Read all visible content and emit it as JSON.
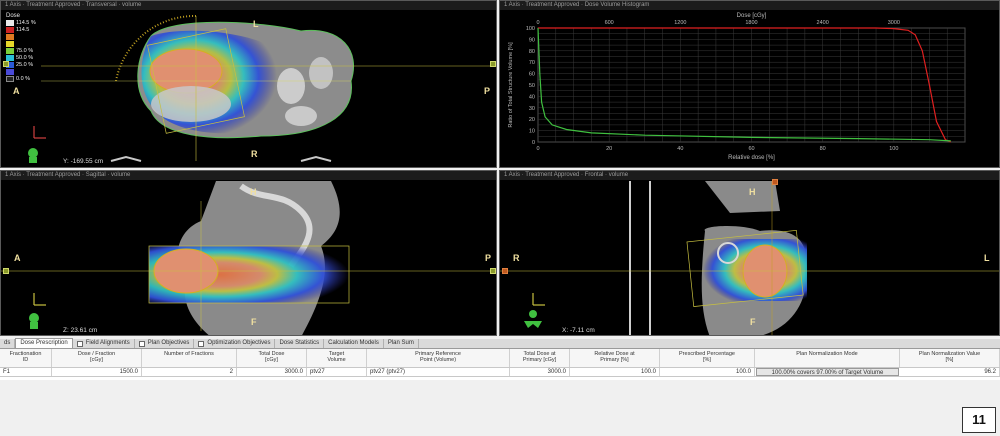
{
  "transverse": {
    "title": "1 Axis · Treatment Approved · Transversal · volume",
    "orient": {
      "top": "L",
      "left": "A",
      "right": "P",
      "bottom": "R"
    },
    "coord": "Y: -169.55 cm"
  },
  "dvh": {
    "title": "1 Axis · Treatment Approved · Dose Volume Histogram",
    "x_title_top": "Dose [cGy]",
    "x_title_bottom": "Relative dose [%]",
    "y_title": "Ratio of Total Structure Volume [%]"
  },
  "sagittal": {
    "title": "1 Axis · Treatment Approved · Sagittal · volume",
    "orient": {
      "top": "H",
      "left": "A",
      "right": "P",
      "bottom": "F"
    },
    "coord": "Z: 23.61 cm"
  },
  "frontal": {
    "title": "1 Axis · Treatment Approved · Frontal · volume",
    "orient": {
      "top": "H",
      "left": "R",
      "right": "L",
      "bottom": "F"
    },
    "coord": "X: -7.11 cm"
  },
  "legend": {
    "header": "Dose",
    "items": [
      {
        "label": "114.5 %",
        "color": "#e8e8e8"
      },
      {
        "label": "114.5",
        "color": "#cc2222"
      },
      {
        "label": "",
        "color": "#e07a22"
      },
      {
        "label": "",
        "color": "#e6d82a"
      },
      {
        "label": "75.0 %",
        "color": "#7ad03a"
      },
      {
        "label": "50.0 %",
        "color": "#2ac0d8"
      },
      {
        "label": "25.0 %",
        "color": "#2a5ad8"
      },
      {
        "label": "",
        "color": "#4a4ad8"
      },
      {
        "label": "0.0 %",
        "color": "#222222"
      }
    ]
  },
  "tabs": [
    {
      "label": "ds",
      "checkbox": false
    },
    {
      "label": "Dose Prescription",
      "checkbox": false
    },
    {
      "label": "Field Alignments",
      "checkbox": true
    },
    {
      "label": "Plan Objectives",
      "checkbox": true
    },
    {
      "label": "Optimization Objectives",
      "checkbox": true
    },
    {
      "label": "Dose Statistics",
      "checkbox": false
    },
    {
      "label": "Calculation Models",
      "checkbox": false
    },
    {
      "label": "Plan Sum",
      "checkbox": false
    }
  ],
  "table": {
    "headers": [
      {
        "l1": "Fractionation",
        "l2": "ID"
      },
      {
        "l1": "Dose / Fraction",
        "l2": "[cGy]"
      },
      {
        "l1": "Number of Fractions",
        "l2": ""
      },
      {
        "l1": "Total Dose",
        "l2": "[cGy]"
      },
      {
        "l1": "Target",
        "l2": "Volume"
      },
      {
        "l1": "Primary Reference",
        "l2": "Point (Volume)"
      },
      {
        "l1": "Total Dose at",
        "l2": "Primary [cGy]"
      },
      {
        "l1": "Relative Dose at",
        "l2": "Primary [%]"
      },
      {
        "l1": "Prescribed Percentage",
        "l2": "[%]"
      },
      {
        "l1": "Plan Normalization Mode",
        "l2": ""
      },
      {
        "l1": "Plan Normalization Value",
        "l2": "[%]"
      }
    ],
    "row": [
      "F1",
      "1500.0",
      "2",
      "3000.0",
      "ptv27",
      "ptv27 (ptv27)",
      "3000.0",
      "100.0",
      "100.0",
      "100.00% covers 97.00% of Target Volume",
      "96.2"
    ]
  },
  "page_number": "11",
  "chart_data": {
    "type": "line",
    "title": "",
    "xlabel": "Relative dose [%]",
    "ylabel": "Ratio of Total Structure Volume [%]",
    "x2label": "Dose [cGy]",
    "xlim": [
      0,
      120
    ],
    "ylim": [
      0,
      100
    ],
    "x_ticks": [
      0,
      20,
      40,
      60,
      80,
      100
    ],
    "x2_ticks": [
      0,
      600,
      1200,
      1800,
      2400,
      3000
    ],
    "y_ticks": [
      0,
      10,
      20,
      30,
      40,
      50,
      60,
      70,
      80,
      90,
      100
    ],
    "grid": true,
    "series": [
      {
        "color": "#e02020",
        "x": [
          0,
          60,
          95,
          100,
          104,
          106,
          108,
          110,
          112,
          114.5,
          116
        ],
        "y": [
          100,
          100,
          100,
          99.5,
          98,
          94,
          80,
          50,
          18,
          2,
          0
        ]
      },
      {
        "color": "#40c040",
        "x": [
          0,
          0.5,
          1,
          2,
          4,
          8,
          15,
          30,
          60,
          90,
          110,
          116
        ],
        "y": [
          100,
          60,
          35,
          22,
          15,
          11,
          8,
          6,
          4,
          3,
          2,
          1
        ]
      }
    ]
  }
}
